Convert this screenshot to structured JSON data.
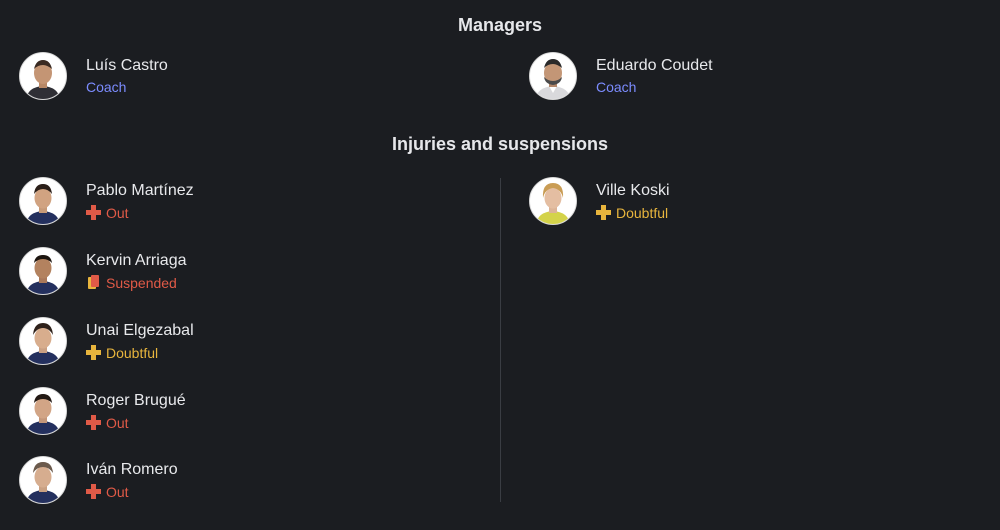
{
  "colors": {
    "background": "#1b1d21",
    "coach": "#7c8cff",
    "out": "#e05a47",
    "suspended": "#e05a47",
    "doubtful": "#e8b53d"
  },
  "managers": {
    "title": "Managers",
    "items": [
      {
        "name": "Luís Castro",
        "role": "Coach"
      },
      {
        "name": "Eduardo Coudet",
        "role": "Coach"
      }
    ]
  },
  "injuries": {
    "title": "Injuries and suspensions",
    "left": [
      {
        "name": "Pablo Martínez",
        "status": "Out",
        "icon": "cross-icon"
      },
      {
        "name": "Kervin Arriaga",
        "status": "Suspended",
        "icon": "red-card-icon"
      },
      {
        "name": "Unai Elgezabal",
        "status": "Doubtful",
        "icon": "cross-icon"
      },
      {
        "name": "Roger Brugué",
        "status": "Out",
        "icon": "cross-icon"
      },
      {
        "name": "Iván Romero",
        "status": "Out",
        "icon": "cross-icon"
      }
    ],
    "right": [
      {
        "name": "Ville Koski",
        "status": "Doubtful",
        "icon": "cross-icon"
      }
    ]
  }
}
